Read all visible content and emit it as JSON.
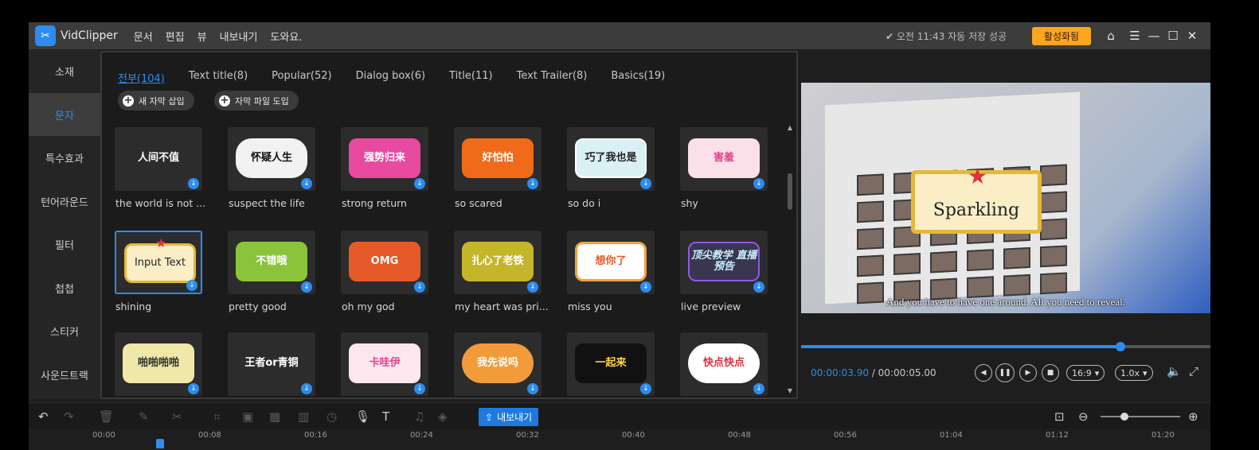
{
  "app": {
    "name": "VidClipper",
    "menu": [
      "문서",
      "편집",
      "뷰",
      "내보내기",
      "도와요."
    ],
    "autosave": "오전 11:43 자동 저장 성공",
    "activate_label": "활성화됨"
  },
  "sidebar": {
    "items": [
      {
        "label": "소재"
      },
      {
        "label": "문자"
      },
      {
        "label": "특수효과"
      },
      {
        "label": "턴어라운드"
      },
      {
        "label": "필터"
      },
      {
        "label": "첩첩"
      },
      {
        "label": "스티커"
      },
      {
        "label": "사운드트랙"
      }
    ],
    "active_index": 1
  },
  "text_panel": {
    "tabs": [
      "전부(104)",
      "Text title(8)",
      "Popular(52)",
      "Dialog box(6)",
      "Title(11)",
      "Text Trailer(8)",
      "Basics(19)"
    ],
    "active_tab": 0,
    "insert_subtitle_label": "새 자막 삽입",
    "import_subtitle_label": "자막 파일 도입",
    "templates": [
      {
        "label": "the world is not ...",
        "art": "人间不值"
      },
      {
        "label": "suspect the life",
        "art": "怀疑人生"
      },
      {
        "label": "strong return",
        "art": "强势归来"
      },
      {
        "label": "so scared",
        "art": "好怕怕"
      },
      {
        "label": "so do i",
        "art": "巧了我也是"
      },
      {
        "label": "shy",
        "art": "害羞"
      },
      {
        "label": "shining",
        "art": "Input Text",
        "selected": true
      },
      {
        "label": "pretty good",
        "art": "不错哦"
      },
      {
        "label": "oh my god",
        "art": "OMG"
      },
      {
        "label": "my heart was pri...",
        "art": "扎心了老铁"
      },
      {
        "label": "miss you",
        "art": "想你了"
      },
      {
        "label": "live preview",
        "art": "顶尖教学 直播预告"
      },
      {
        "label": "",
        "art": "啪啪啪啪"
      },
      {
        "label": "",
        "art": "王者or青铜"
      },
      {
        "label": "",
        "art": "卡哇伊"
      },
      {
        "label": "",
        "art": "我先说吗"
      },
      {
        "label": "",
        "art": "一起来"
      },
      {
        "label": "",
        "art": "快点快点"
      }
    ]
  },
  "preview": {
    "overlay_title": "Sparkling",
    "subtitle_text": "And you have to have one around. All you need to reveal.",
    "current_time": "00:00:03.90",
    "total_time": "/ 00:00:05.00",
    "progress_fraction": 0.78,
    "aspect_ratio": "16:9",
    "speed": "1.0x"
  },
  "toolbar": {
    "export_label": "내보내기",
    "zoom_fraction": 0.3
  },
  "timeline": {
    "ticks": [
      "00:00",
      "00:08",
      "00:16",
      "00:24",
      "00:32",
      "00:40",
      "00:48",
      "00:56",
      "01:04",
      "01:12",
      "01:20"
    ]
  },
  "colors": {
    "accent": "#2d8cf0",
    "activate": "#ffa51f"
  }
}
